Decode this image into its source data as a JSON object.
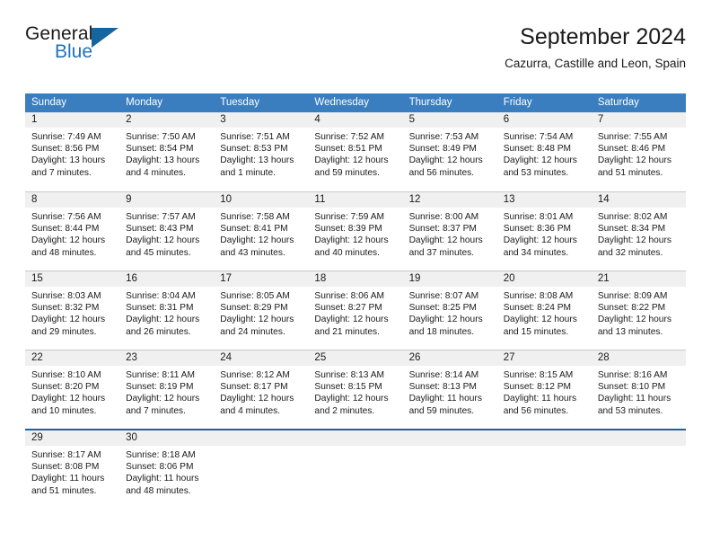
{
  "brand": {
    "name_part1": "General",
    "name_part2": "Blue",
    "accent_color": "#1f72bd",
    "flag_color": "#15659f"
  },
  "header": {
    "title": "September 2024",
    "subtitle": "Cazurra, Castille and Leon, Spain"
  },
  "calendar": {
    "header_bg": "#3a7ebf",
    "daynum_bg": "#f0f0f0",
    "weekdays": [
      "Sunday",
      "Monday",
      "Tuesday",
      "Wednesday",
      "Thursday",
      "Friday",
      "Saturday"
    ],
    "weeks": [
      {
        "days": [
          {
            "num": "1",
            "sunrise": "Sunrise: 7:49 AM",
            "sunset": "Sunset: 8:56 PM",
            "daylight_line1": "Daylight: 13 hours",
            "daylight_line2": "and 7 minutes."
          },
          {
            "num": "2",
            "sunrise": "Sunrise: 7:50 AM",
            "sunset": "Sunset: 8:54 PM",
            "daylight_line1": "Daylight: 13 hours",
            "daylight_line2": "and 4 minutes."
          },
          {
            "num": "3",
            "sunrise": "Sunrise: 7:51 AM",
            "sunset": "Sunset: 8:53 PM",
            "daylight_line1": "Daylight: 13 hours",
            "daylight_line2": "and 1 minute."
          },
          {
            "num": "4",
            "sunrise": "Sunrise: 7:52 AM",
            "sunset": "Sunset: 8:51 PM",
            "daylight_line1": "Daylight: 12 hours",
            "daylight_line2": "and 59 minutes."
          },
          {
            "num": "5",
            "sunrise": "Sunrise: 7:53 AM",
            "sunset": "Sunset: 8:49 PM",
            "daylight_line1": "Daylight: 12 hours",
            "daylight_line2": "and 56 minutes."
          },
          {
            "num": "6",
            "sunrise": "Sunrise: 7:54 AM",
            "sunset": "Sunset: 8:48 PM",
            "daylight_line1": "Daylight: 12 hours",
            "daylight_line2": "and 53 minutes."
          },
          {
            "num": "7",
            "sunrise": "Sunrise: 7:55 AM",
            "sunset": "Sunset: 8:46 PM",
            "daylight_line1": "Daylight: 12 hours",
            "daylight_line2": "and 51 minutes."
          }
        ]
      },
      {
        "days": [
          {
            "num": "8",
            "sunrise": "Sunrise: 7:56 AM",
            "sunset": "Sunset: 8:44 PM",
            "daylight_line1": "Daylight: 12 hours",
            "daylight_line2": "and 48 minutes."
          },
          {
            "num": "9",
            "sunrise": "Sunrise: 7:57 AM",
            "sunset": "Sunset: 8:43 PM",
            "daylight_line1": "Daylight: 12 hours",
            "daylight_line2": "and 45 minutes."
          },
          {
            "num": "10",
            "sunrise": "Sunrise: 7:58 AM",
            "sunset": "Sunset: 8:41 PM",
            "daylight_line1": "Daylight: 12 hours",
            "daylight_line2": "and 43 minutes."
          },
          {
            "num": "11",
            "sunrise": "Sunrise: 7:59 AM",
            "sunset": "Sunset: 8:39 PM",
            "daylight_line1": "Daylight: 12 hours",
            "daylight_line2": "and 40 minutes."
          },
          {
            "num": "12",
            "sunrise": "Sunrise: 8:00 AM",
            "sunset": "Sunset: 8:37 PM",
            "daylight_line1": "Daylight: 12 hours",
            "daylight_line2": "and 37 minutes."
          },
          {
            "num": "13",
            "sunrise": "Sunrise: 8:01 AM",
            "sunset": "Sunset: 8:36 PM",
            "daylight_line1": "Daylight: 12 hours",
            "daylight_line2": "and 34 minutes."
          },
          {
            "num": "14",
            "sunrise": "Sunrise: 8:02 AM",
            "sunset": "Sunset: 8:34 PM",
            "daylight_line1": "Daylight: 12 hours",
            "daylight_line2": "and 32 minutes."
          }
        ]
      },
      {
        "days": [
          {
            "num": "15",
            "sunrise": "Sunrise: 8:03 AM",
            "sunset": "Sunset: 8:32 PM",
            "daylight_line1": "Daylight: 12 hours",
            "daylight_line2": "and 29 minutes."
          },
          {
            "num": "16",
            "sunrise": "Sunrise: 8:04 AM",
            "sunset": "Sunset: 8:31 PM",
            "daylight_line1": "Daylight: 12 hours",
            "daylight_line2": "and 26 minutes."
          },
          {
            "num": "17",
            "sunrise": "Sunrise: 8:05 AM",
            "sunset": "Sunset: 8:29 PM",
            "daylight_line1": "Daylight: 12 hours",
            "daylight_line2": "and 24 minutes."
          },
          {
            "num": "18",
            "sunrise": "Sunrise: 8:06 AM",
            "sunset": "Sunset: 8:27 PM",
            "daylight_line1": "Daylight: 12 hours",
            "daylight_line2": "and 21 minutes."
          },
          {
            "num": "19",
            "sunrise": "Sunrise: 8:07 AM",
            "sunset": "Sunset: 8:25 PM",
            "daylight_line1": "Daylight: 12 hours",
            "daylight_line2": "and 18 minutes."
          },
          {
            "num": "20",
            "sunrise": "Sunrise: 8:08 AM",
            "sunset": "Sunset: 8:24 PM",
            "daylight_line1": "Daylight: 12 hours",
            "daylight_line2": "and 15 minutes."
          },
          {
            "num": "21",
            "sunrise": "Sunrise: 8:09 AM",
            "sunset": "Sunset: 8:22 PM",
            "daylight_line1": "Daylight: 12 hours",
            "daylight_line2": "and 13 minutes."
          }
        ]
      },
      {
        "days": [
          {
            "num": "22",
            "sunrise": "Sunrise: 8:10 AM",
            "sunset": "Sunset: 8:20 PM",
            "daylight_line1": "Daylight: 12 hours",
            "daylight_line2": "and 10 minutes."
          },
          {
            "num": "23",
            "sunrise": "Sunrise: 8:11 AM",
            "sunset": "Sunset: 8:19 PM",
            "daylight_line1": "Daylight: 12 hours",
            "daylight_line2": "and 7 minutes."
          },
          {
            "num": "24",
            "sunrise": "Sunrise: 8:12 AM",
            "sunset": "Sunset: 8:17 PM",
            "daylight_line1": "Daylight: 12 hours",
            "daylight_line2": "and 4 minutes."
          },
          {
            "num": "25",
            "sunrise": "Sunrise: 8:13 AM",
            "sunset": "Sunset: 8:15 PM",
            "daylight_line1": "Daylight: 12 hours",
            "daylight_line2": "and 2 minutes."
          },
          {
            "num": "26",
            "sunrise": "Sunrise: 8:14 AM",
            "sunset": "Sunset: 8:13 PM",
            "daylight_line1": "Daylight: 11 hours",
            "daylight_line2": "and 59 minutes."
          },
          {
            "num": "27",
            "sunrise": "Sunrise: 8:15 AM",
            "sunset": "Sunset: 8:12 PM",
            "daylight_line1": "Daylight: 11 hours",
            "daylight_line2": "and 56 minutes."
          },
          {
            "num": "28",
            "sunrise": "Sunrise: 8:16 AM",
            "sunset": "Sunset: 8:10 PM",
            "daylight_line1": "Daylight: 11 hours",
            "daylight_line2": "and 53 minutes."
          }
        ]
      },
      {
        "days": [
          {
            "num": "29",
            "sunrise": "Sunrise: 8:17 AM",
            "sunset": "Sunset: 8:08 PM",
            "daylight_line1": "Daylight: 11 hours",
            "daylight_line2": "and 51 minutes."
          },
          {
            "num": "30",
            "sunrise": "Sunrise: 8:18 AM",
            "sunset": "Sunset: 8:06 PM",
            "daylight_line1": "Daylight: 11 hours",
            "daylight_line2": "and 48 minutes."
          },
          {
            "num": "",
            "sunrise": "",
            "sunset": "",
            "daylight_line1": "",
            "daylight_line2": ""
          },
          {
            "num": "",
            "sunrise": "",
            "sunset": "",
            "daylight_line1": "",
            "daylight_line2": ""
          },
          {
            "num": "",
            "sunrise": "",
            "sunset": "",
            "daylight_line1": "",
            "daylight_line2": ""
          },
          {
            "num": "",
            "sunrise": "",
            "sunset": "",
            "daylight_line1": "",
            "daylight_line2": ""
          },
          {
            "num": "",
            "sunrise": "",
            "sunset": "",
            "daylight_line1": "",
            "daylight_line2": ""
          }
        ]
      }
    ]
  }
}
